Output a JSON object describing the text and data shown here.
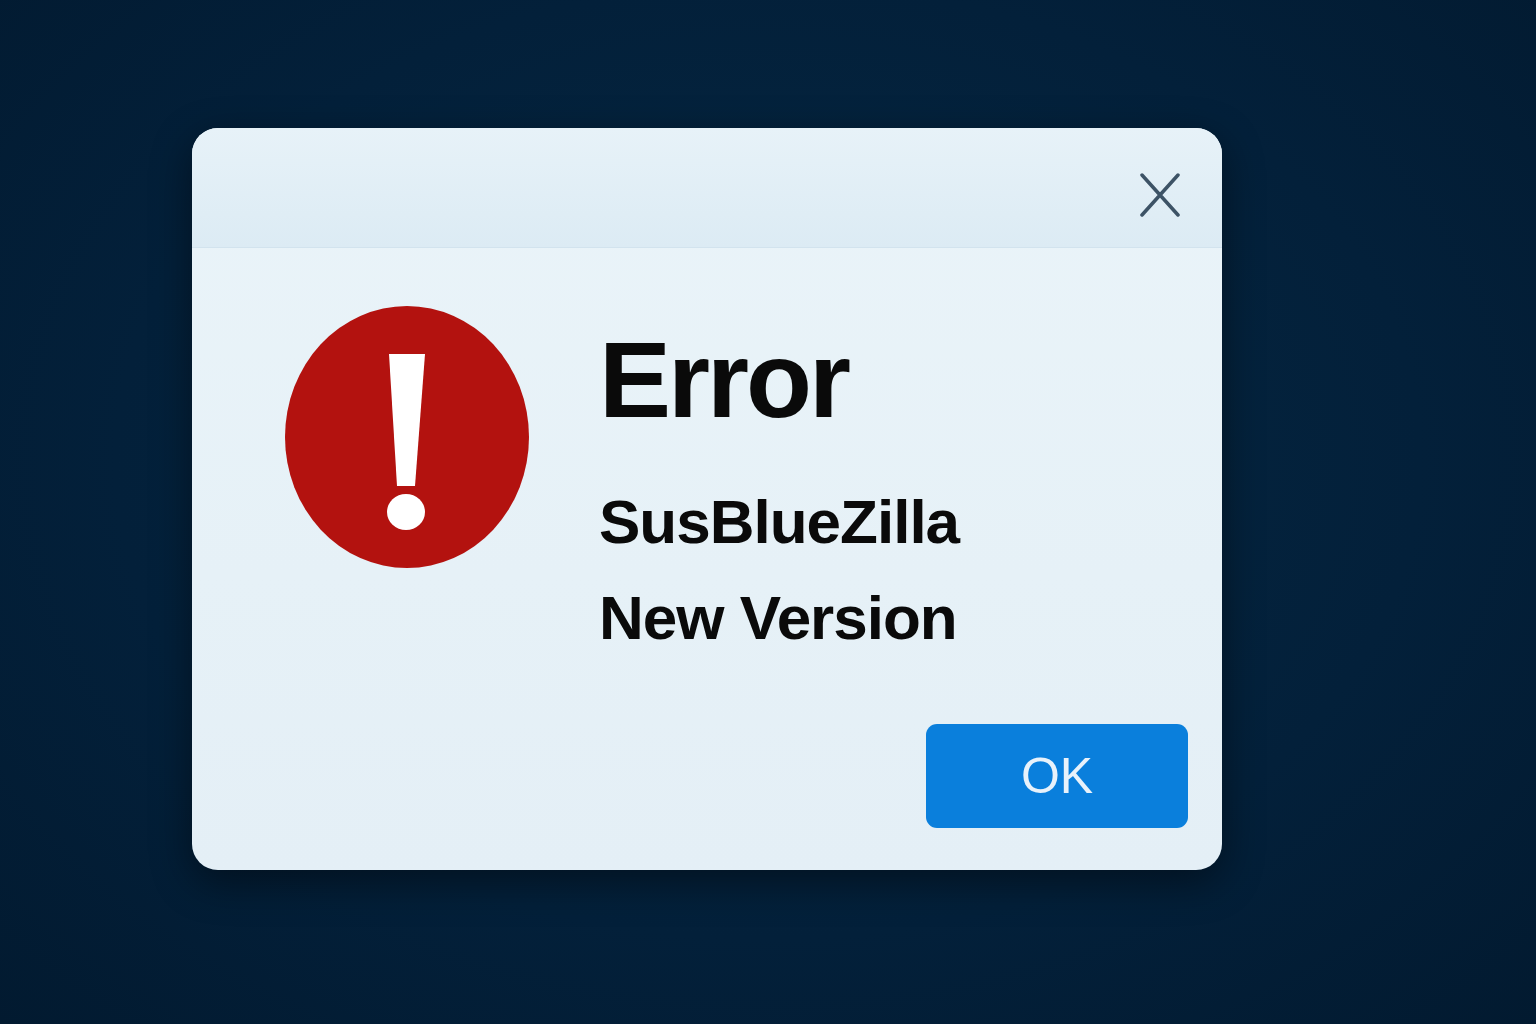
{
  "dialog": {
    "heading": "Error",
    "message_lines": [
      "SusBlueZilla",
      "New Version"
    ],
    "buttons": [
      "OK"
    ]
  }
}
